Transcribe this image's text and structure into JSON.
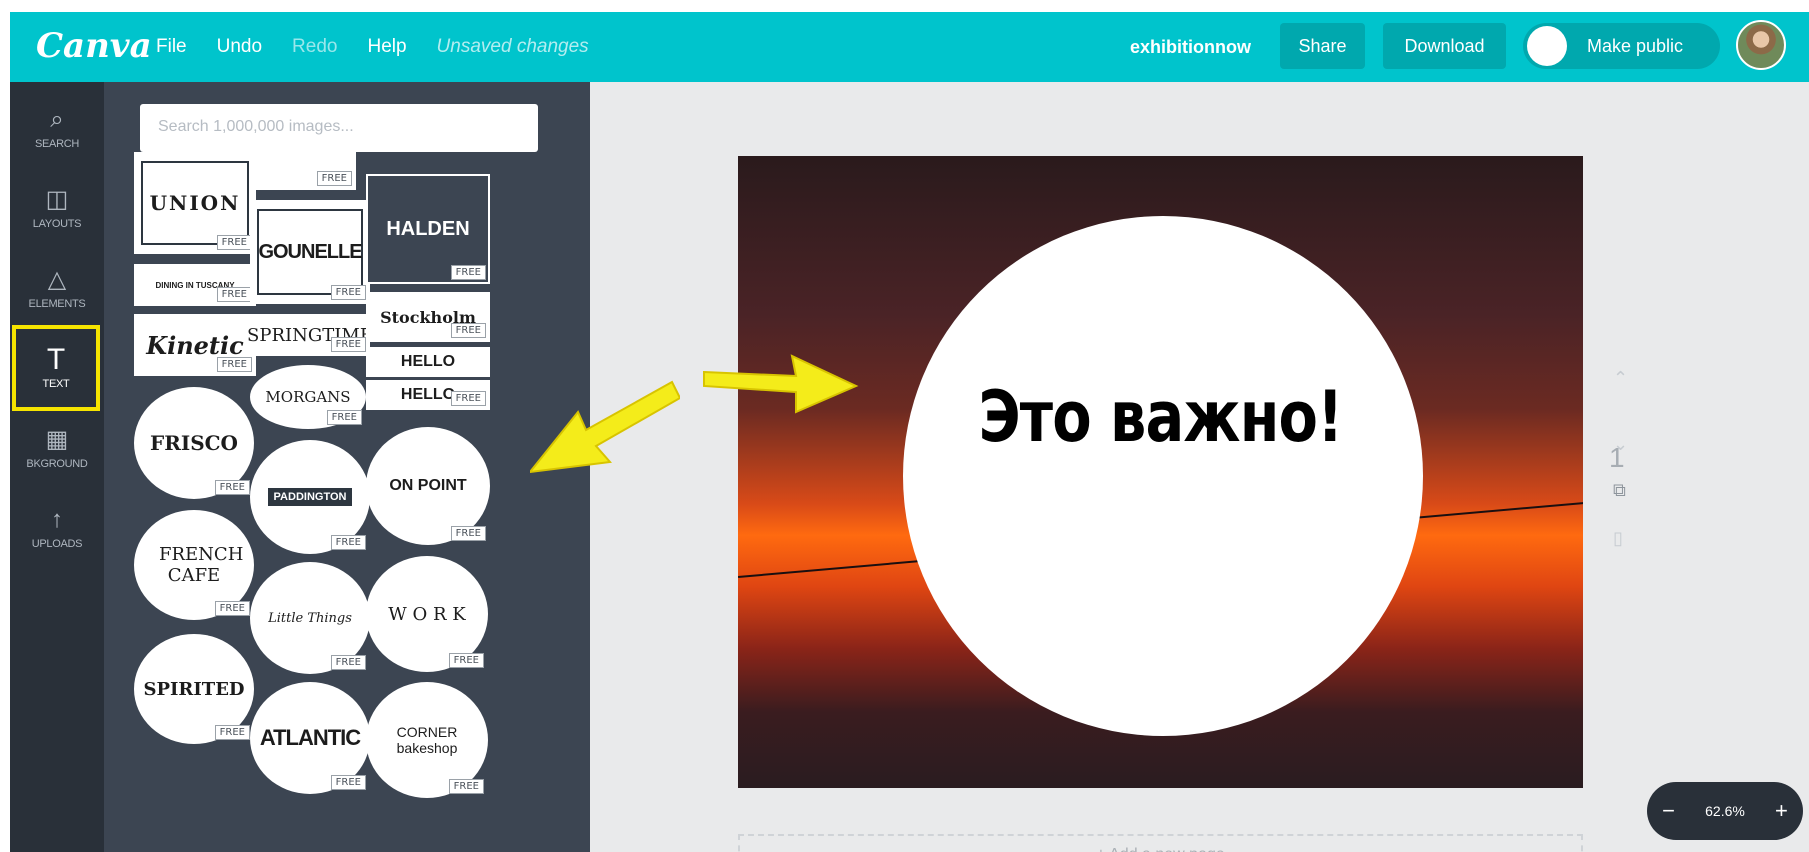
{
  "topbar": {
    "logo": "Canva",
    "menu": [
      "File",
      "Undo",
      "Redo",
      "Help",
      "Unsaved changes"
    ],
    "site_name": "exhibitionnow",
    "share_label": "Share",
    "download_label": "Download",
    "public_label": "Make public"
  },
  "rail": {
    "items": [
      {
        "icon": "⌕",
        "label": "SEARCH"
      },
      {
        "icon": "◫",
        "label": "LAYOUTS"
      },
      {
        "icon": "△",
        "label": "ELEMENTS"
      },
      {
        "icon": "T",
        "label": "TEXT"
      },
      {
        "icon": "▦",
        "label": "BKGROUND"
      },
      {
        "icon": "↑",
        "label": "UPLOADS"
      }
    ]
  },
  "panel": {
    "search_placeholder": "Search 1,000,000 images...",
    "free_label": "FREE",
    "tiles": [
      "UNION",
      "GOUNELLE",
      "HALDEN",
      "DINING IN TUSCANY",
      "Stockholm",
      "Kinetic",
      "SPRINGTIME",
      "HELLO",
      "HELLO",
      "MORGANS",
      "FRISCO",
      "ON POINT",
      "PADDINGTON",
      "FRENCH CAFE",
      "Little Things",
      "W O R K",
      "SPIRITED",
      "ATLANTIC",
      "CORNER bakeshop"
    ]
  },
  "canvas": {
    "headline": "Это важно!",
    "page_number": "1",
    "add_page": "+ Add a new page",
    "zoom": "62.6%"
  },
  "colors": {
    "brand": "#00c4cc",
    "rail": "#293039",
    "panel": "#3c4552",
    "highlight": "#f6e400"
  }
}
